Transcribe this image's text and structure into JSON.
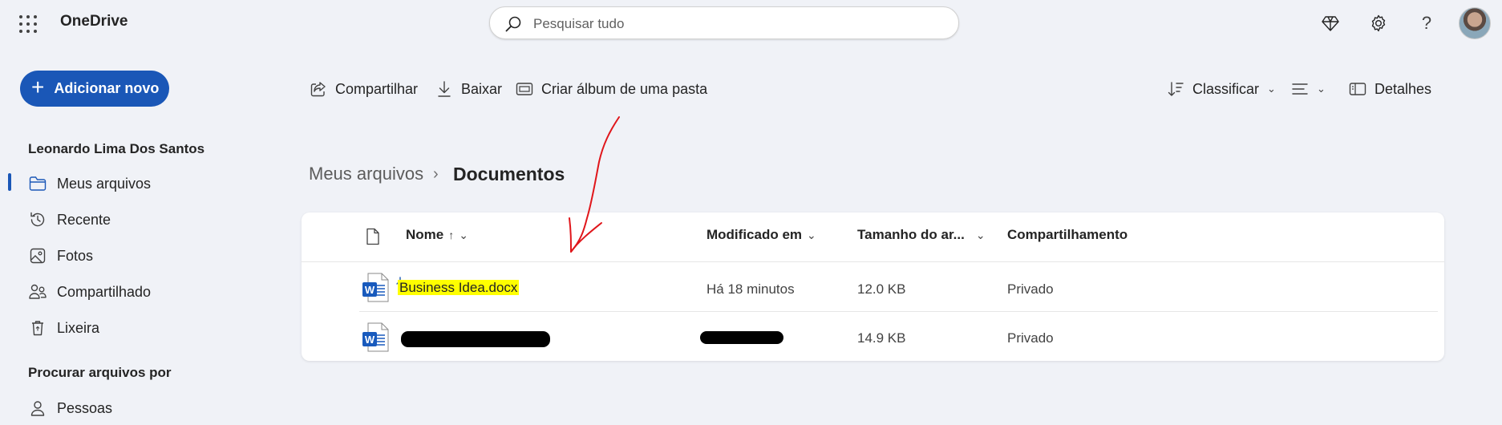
{
  "topbar": {
    "app_name": "OneDrive",
    "search_placeholder": "Pesquisar tudo"
  },
  "sidebar": {
    "add_new_label": "Adicionar novo",
    "user_name": "Leonardo Lima Dos Santos",
    "items": [
      {
        "label": "Meus arquivos",
        "icon": "folder-icon",
        "active": true
      },
      {
        "label": "Recente",
        "icon": "history-icon"
      },
      {
        "label": "Fotos",
        "icon": "image-icon"
      },
      {
        "label": "Compartilhado",
        "icon": "people-icon"
      },
      {
        "label": "Lixeira",
        "icon": "recycle-bin-icon"
      }
    ],
    "browse_title": "Procurar arquivos por",
    "browse_items": [
      {
        "label": "Pessoas",
        "icon": "person-icon"
      }
    ]
  },
  "commands": {
    "share": "Compartilhar",
    "download": "Baixar",
    "create_album": "Criar álbum de uma pasta",
    "sort": "Classificar",
    "details": "Detalhes"
  },
  "breadcrumb": {
    "root": "Meus arquivos",
    "separator": "›",
    "current": "Documentos"
  },
  "table": {
    "columns": {
      "name": "Nome",
      "sort_arrow": "↑",
      "modified": "Modificado em",
      "size": "Tamanho do ar...",
      "sharing": "Compartilhamento"
    },
    "rows": [
      {
        "name": "Business Idea.docx",
        "modified": "Há 18 minutos",
        "size": "12.0 KB",
        "sharing": "Privado"
      },
      {
        "name": "",
        "modified": "",
        "size": "14.9 KB",
        "sharing": "Privado"
      }
    ]
  },
  "colors": {
    "accent": "#1a57b7",
    "background": "#f0f2f7",
    "highlight": "#ffff00",
    "annotation": "#e0161b",
    "word_blue": "#185abd"
  }
}
